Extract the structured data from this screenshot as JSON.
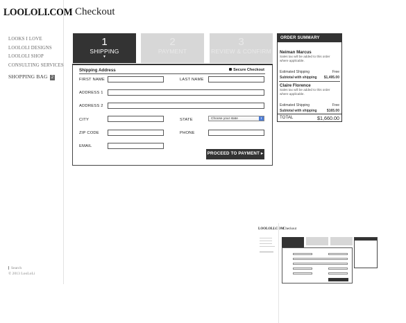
{
  "sidebar": {
    "logo": "LOOLOLI.COM",
    "nav": [
      "LOOKS I LOVE",
      "LOOLOLI DESIGNS",
      "LOOLOLI SHOP",
      "CONSULTING SERVICES"
    ],
    "bag_label": "SHOPPING BAG",
    "bag_count": "2",
    "footer_search": "Search",
    "footer_copyright": "© 2013 LooLoLi"
  },
  "page": {
    "title": "Checkout"
  },
  "steps": [
    {
      "number": "1",
      "label": "SHIPPING",
      "arrow": "▼",
      "active": true
    },
    {
      "number": "2",
      "label": "PAYMENT",
      "active": false
    },
    {
      "number": "3",
      "label": "REVIEW & CONFIRM",
      "active": false
    }
  ],
  "form": {
    "section_title": "Shipping Address",
    "secure_label": "Secure Checkout",
    "fields": {
      "first_name": "FIRST NAME",
      "last_name": "LAST NAME",
      "address1": "ADDRESS 1",
      "address2": "ADDRESS 2",
      "city": "CITY",
      "state": "STATE",
      "zip": "ZIP CODE",
      "phone": "PHONE",
      "email": "EMAIL"
    },
    "state_select": "Choose your state",
    "submit": "PROCEED TO PAYMENT ▸"
  },
  "order_summary": {
    "title": "ORDER SUMMARY",
    "vendors": [
      {
        "name": "Neiman Marcus",
        "tax_note": "Sales tax will be added to this order where applicable.",
        "shipping_label": "Estimated Shipping",
        "shipping_value": "Free",
        "subtotal_label": "Subtotal with shipping",
        "subtotal_value": "$1,495.00"
      },
      {
        "name": "Claire Florence",
        "tax_note": "Sales tax will be added to this order where applicable.",
        "shipping_label": "Estimated Shipping",
        "shipping_value": "Free",
        "subtotal_label": "Subtotal with shipping",
        "subtotal_value": "$165.00"
      }
    ],
    "total_label": "TOTAL",
    "total_value": "$1,660.00"
  },
  "colors": {
    "dark": "#333333",
    "inactive_step": "#d7d7d7",
    "select_accent": "#4a7bd6"
  }
}
